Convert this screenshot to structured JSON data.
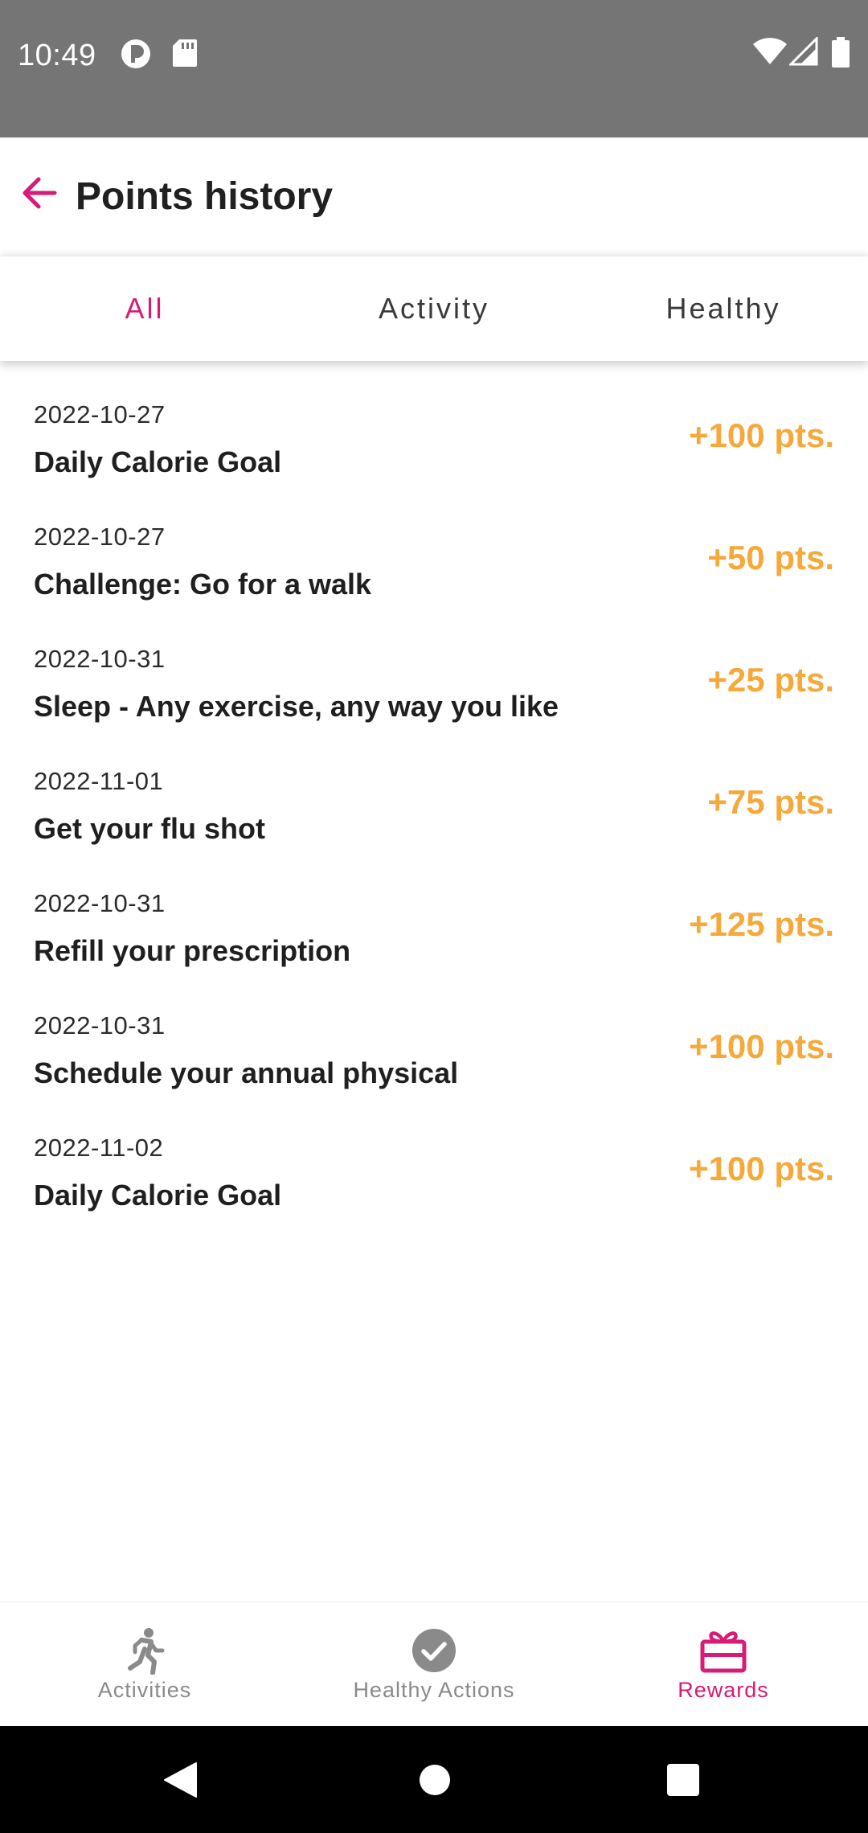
{
  "status_bar": {
    "time": "10:49"
  },
  "header": {
    "title": "Points history"
  },
  "tabs": [
    {
      "label": "All",
      "active": true
    },
    {
      "label": "Activity",
      "active": false
    },
    {
      "label": "Healthy",
      "active": false
    }
  ],
  "history": [
    {
      "date": "2022-10-27",
      "title": "Daily Calorie Goal",
      "points": "+100 pts."
    },
    {
      "date": "2022-10-27",
      "title": "Challenge: Go for a walk",
      "points": "+50 pts."
    },
    {
      "date": "2022-10-31",
      "title": "Sleep - Any exercise, any way you like",
      "points": "+25 pts."
    },
    {
      "date": "2022-11-01",
      "title": "Get your flu shot",
      "points": "+75 pts."
    },
    {
      "date": "2022-10-31",
      "title": "Refill your prescription",
      "points": "+125 pts."
    },
    {
      "date": "2022-10-31",
      "title": "Schedule your annual physical",
      "points": "+100 pts."
    },
    {
      "date": "2022-11-02",
      "title": "Daily Calorie Goal",
      "points": "+100 pts."
    }
  ],
  "bottom_nav": [
    {
      "label": "Activities",
      "icon": "running-person-icon",
      "active": false
    },
    {
      "label": "Healthy Actions",
      "icon": "check-circle-icon",
      "active": false
    },
    {
      "label": "Rewards",
      "icon": "gift-box-icon",
      "active": true
    }
  ],
  "colors": {
    "accent": "#d81b74",
    "points": "#f6a93b",
    "status_bar": "#757575"
  }
}
